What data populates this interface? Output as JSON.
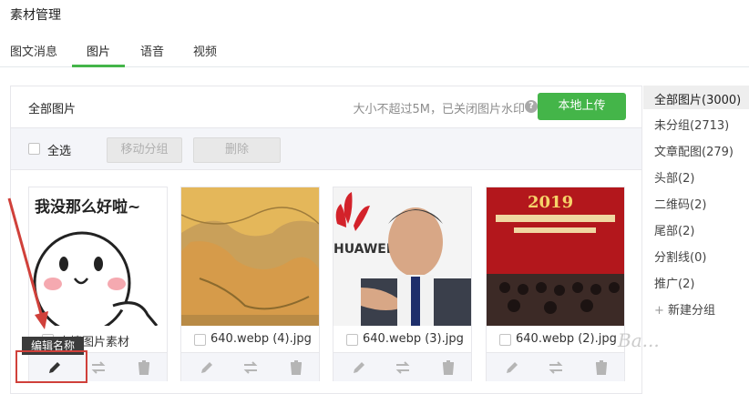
{
  "page": {
    "title": "素材管理"
  },
  "tabs": [
    {
      "label": "图文消息"
    },
    {
      "label": "图片"
    },
    {
      "label": "语音"
    },
    {
      "label": "视频"
    }
  ],
  "panel": {
    "title": "全部图片",
    "hint": "大小不超过5M，已关闭图片水印",
    "upload_label": "本地上传"
  },
  "toolbar": {
    "select_all": "全选",
    "move_group": "移动分组",
    "delete": "删除"
  },
  "cards": [
    {
      "name": "表情图片素材",
      "thumb_text": "我没那么好啦~"
    },
    {
      "name": "640.webp (4).jpg"
    },
    {
      "name": "640.webp (3).jpg",
      "thumb_text": "HUAWEI"
    },
    {
      "name": "640.webp (2).jpg",
      "thumb_text": "2019"
    }
  ],
  "tooltip": "编辑名称",
  "sidebar": [
    {
      "label": "全部图片(3000)"
    },
    {
      "label": "未分组(2713)"
    },
    {
      "label": "文章配图(279)"
    },
    {
      "label": "头部(2)"
    },
    {
      "label": "二维码(2)"
    },
    {
      "label": "尾部(2)"
    },
    {
      "label": "分割线(0)"
    },
    {
      "label": "推广(2)"
    }
  ],
  "new_group": "新建分组",
  "watermark": "Ba...",
  "colors": {
    "accent": "#44b549",
    "highlight": "#d0403a"
  }
}
